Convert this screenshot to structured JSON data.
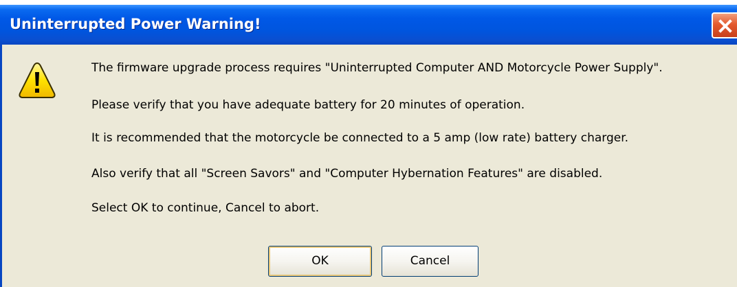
{
  "dialog": {
    "title": "Uninterrupted Power Warning!",
    "icons": {
      "warning": "warning-icon",
      "close": "close-icon"
    },
    "messages": [
      "The firmware upgrade process requires \"Uninterrupted Computer AND Motorcycle Power Supply\".",
      "Please verify that you have adequate battery for 20 minutes of operation.",
      "It is recommended that the motorcycle be connected to a  5 amp (low rate) battery charger.",
      "Also verify that all \"Screen Savors\" and \"Computer Hybernation Features\" are disabled.",
      "Select OK to continue, Cancel to abort."
    ],
    "buttons": {
      "ok_label": "OK",
      "cancel_label": "Cancel"
    },
    "colors": {
      "titlebar": "#0058e6",
      "background": "#ece9d8",
      "close_button": "#e35a2f",
      "warning_yellow": "#ffe100"
    }
  }
}
